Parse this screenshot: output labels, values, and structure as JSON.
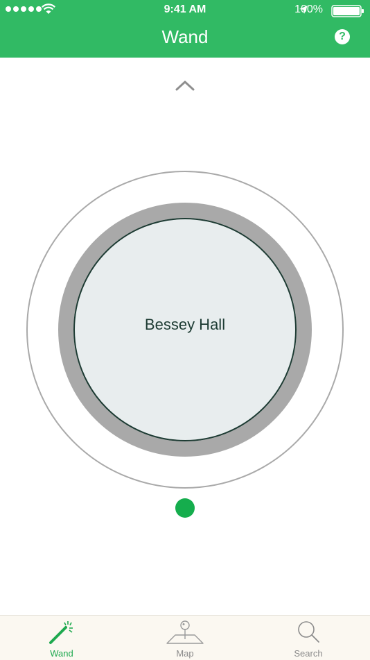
{
  "status_bar": {
    "time": "9:41 AM",
    "battery": "100%",
    "icons": [
      "signal-dots-icon",
      "wifi-icon",
      "location-arrow-icon",
      "battery-icon"
    ]
  },
  "header": {
    "title": "Wand",
    "help_label": "?",
    "help_icon": "help-circle-icon"
  },
  "main": {
    "up_icon": "chevron-up-icon",
    "building_name": "Bessey Hall"
  },
  "tabbar": {
    "tabs": [
      {
        "label": "Wand",
        "icon": "wand-icon",
        "active": true
      },
      {
        "label": "Map",
        "icon": "map-pin-icon",
        "active": false
      },
      {
        "label": "Search",
        "icon": "search-icon",
        "active": false
      }
    ]
  },
  "colors": {
    "brand_green": "#31ba64",
    "active_tab": "#1ea94f",
    "indicator": "#15ad4d",
    "ring_gray": "#a9a9a9",
    "inner_fill": "#e8edee",
    "inner_stroke": "#1d3b33"
  }
}
